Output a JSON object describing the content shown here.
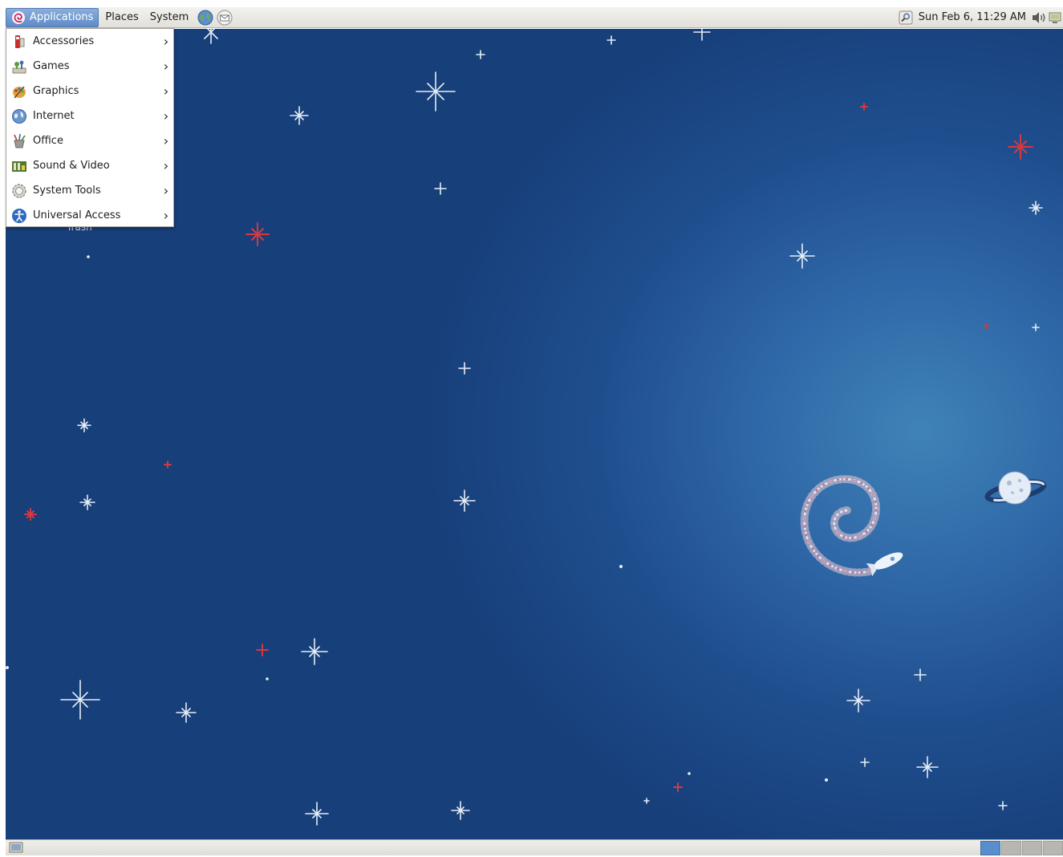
{
  "top_panel": {
    "menus": [
      {
        "label": "Applications",
        "active": true
      },
      {
        "label": "Places",
        "active": false
      },
      {
        "label": "System",
        "active": false
      }
    ],
    "launchers": [
      "web-browser-icon",
      "mail-client-icon"
    ],
    "tray": {
      "search_icon": "search-tool-icon",
      "clock": "Sun Feb  6, 11:29 AM",
      "volume_icon": "volume-icon",
      "network_icon": "network-icon"
    }
  },
  "applications_menu": {
    "items": [
      {
        "label": "Accessories",
        "icon": "accessories-icon"
      },
      {
        "label": "Games",
        "icon": "games-icon"
      },
      {
        "label": "Graphics",
        "icon": "graphics-icon"
      },
      {
        "label": "Internet",
        "icon": "internet-icon"
      },
      {
        "label": "Office",
        "icon": "office-icon"
      },
      {
        "label": "Sound & Video",
        "icon": "sound-video-icon"
      },
      {
        "label": "System Tools",
        "icon": "system-tools-icon"
      },
      {
        "label": "Universal Access",
        "icon": "universal-access-icon"
      }
    ]
  },
  "desktop": {
    "trash_label": "Trash",
    "wallpaper": "debian-space-fun",
    "colors": {
      "accent_star": "#c8323a",
      "background": "#1f4e8e"
    }
  },
  "bottom_panel": {
    "workspaces": 4,
    "active_workspace": 1
  }
}
